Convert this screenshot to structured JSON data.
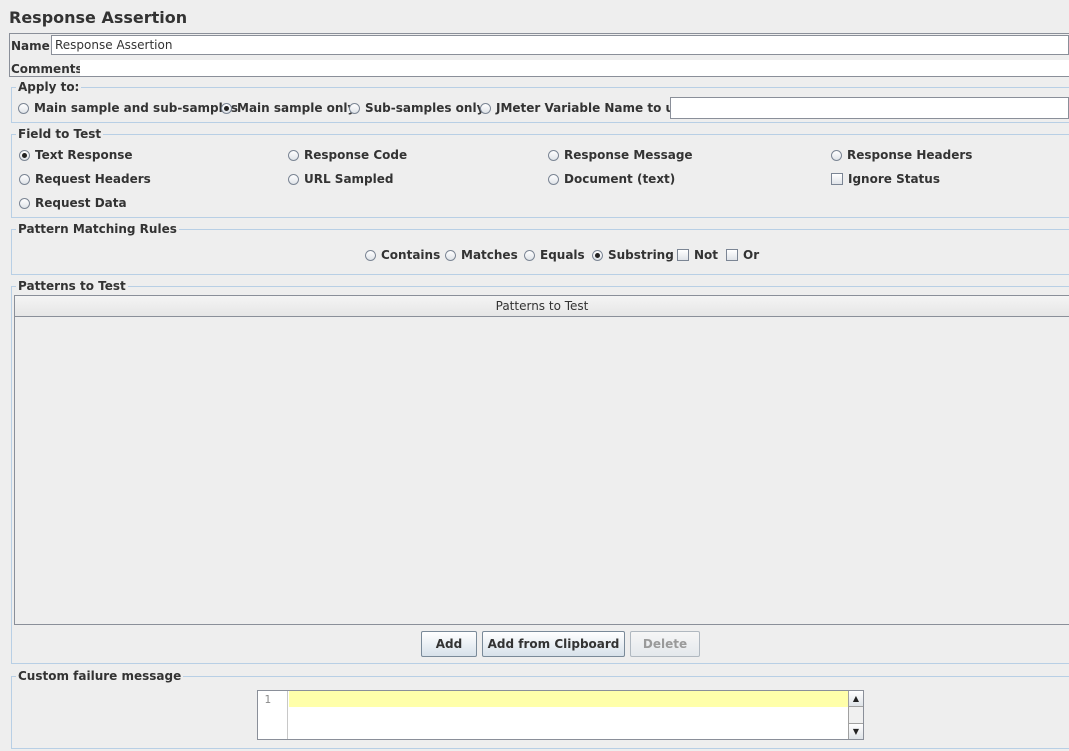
{
  "panel": {
    "title": "Response Assertion"
  },
  "name_field": {
    "label": "Name:",
    "value": "Response Assertion"
  },
  "comments_field": {
    "label": "Comments:",
    "value": ""
  },
  "apply_to": {
    "title": "Apply to:",
    "options": [
      {
        "label": "Main sample and sub-samples",
        "selected": false
      },
      {
        "label": "Main sample only",
        "selected": true
      },
      {
        "label": "Sub-samples only",
        "selected": false
      },
      {
        "label": "JMeter Variable Name to use",
        "selected": false
      }
    ],
    "variable_value": ""
  },
  "field_to_test": {
    "title": "Field to Test",
    "options": [
      {
        "label": "Text Response",
        "selected": true
      },
      {
        "label": "Response Code",
        "selected": false
      },
      {
        "label": "Response Message",
        "selected": false
      },
      {
        "label": "Response Headers",
        "selected": false
      },
      {
        "label": "Request Headers",
        "selected": false
      },
      {
        "label": "URL Sampled",
        "selected": false
      },
      {
        "label": "Document (text)",
        "selected": false
      },
      {
        "label": "Request Data",
        "selected": false
      }
    ],
    "ignore_status": {
      "label": "Ignore Status",
      "checked": false
    }
  },
  "pattern_rules": {
    "title": "Pattern Matching Rules",
    "options": [
      {
        "label": "Contains",
        "selected": false
      },
      {
        "label": "Matches",
        "selected": false
      },
      {
        "label": "Equals",
        "selected": false
      },
      {
        "label": "Substring",
        "selected": true
      }
    ],
    "not": {
      "label": "Not",
      "checked": false
    },
    "or": {
      "label": "Or",
      "checked": false
    }
  },
  "patterns": {
    "title": "Patterns to Test",
    "column_header": "Patterns to Test",
    "rows": [],
    "buttons": {
      "add": "Add",
      "add_clipboard": "Add from Clipboard",
      "delete": "Delete"
    }
  },
  "failure_message": {
    "title": "Custom failure message",
    "line_number": "1",
    "text": ""
  },
  "colors": {
    "background": "#eeeeee",
    "current_line": "#ffffaa",
    "group_border": "#b8cfe5"
  }
}
